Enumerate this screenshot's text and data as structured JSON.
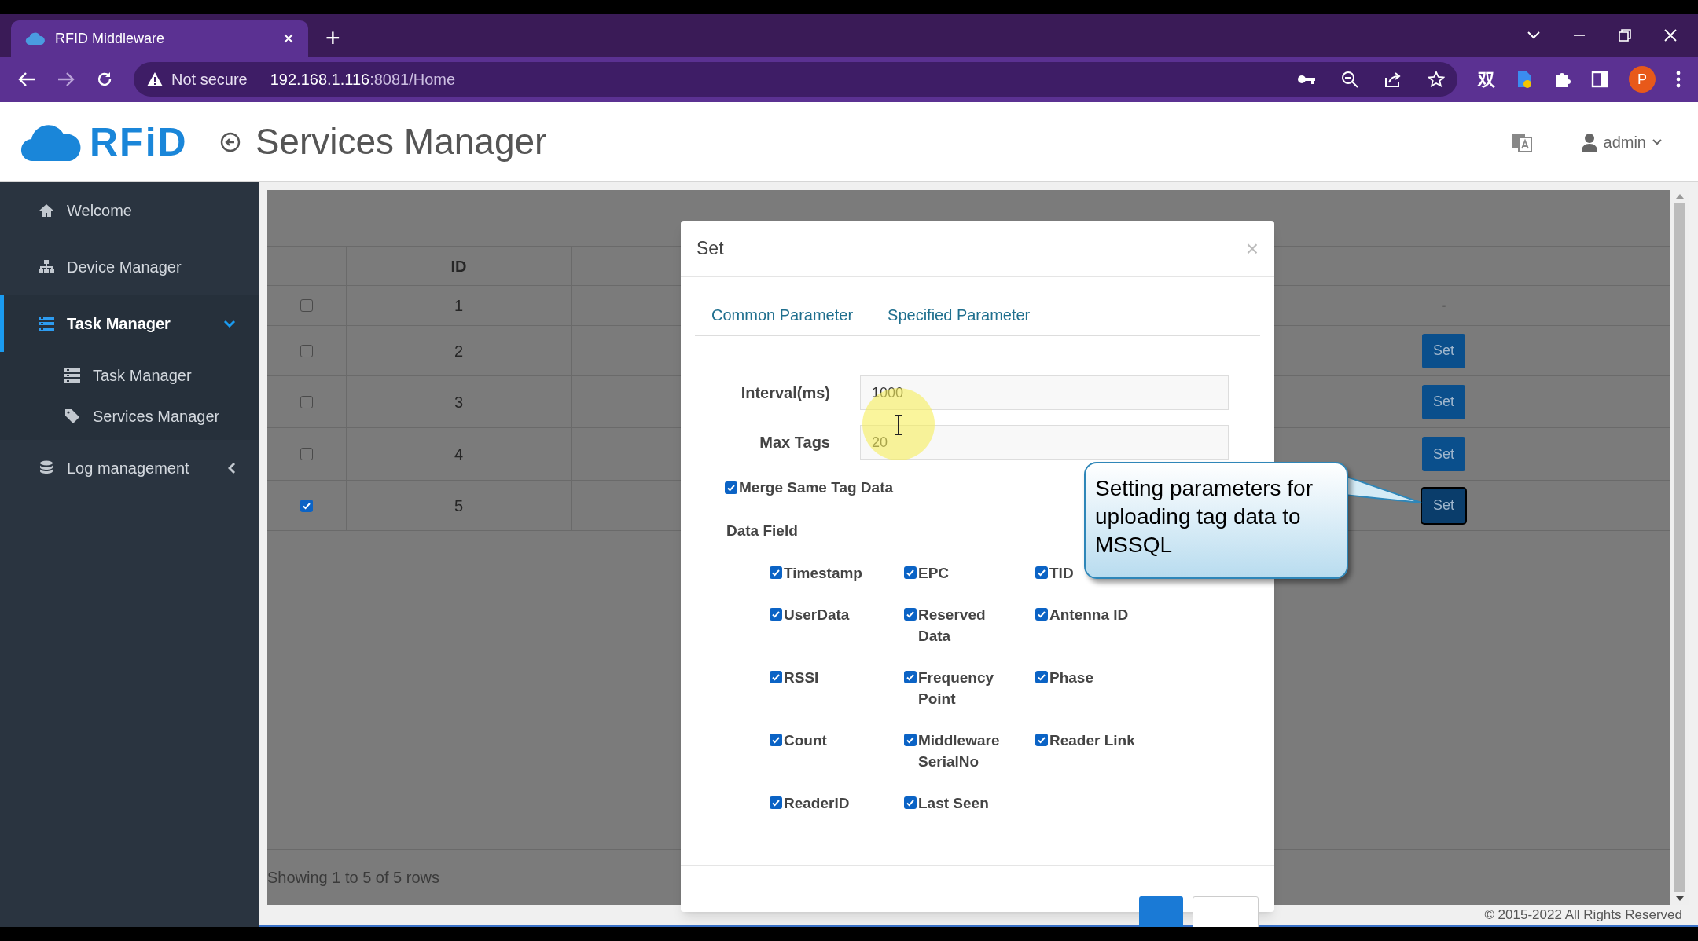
{
  "browser": {
    "tab_title": "RFID Middleware",
    "new_tab": "+",
    "security": "Not secure",
    "url_host": "192.168.1.116",
    "url_path": ":8081/Home",
    "extension_label": "双",
    "profile_initial": "P"
  },
  "header": {
    "logo_text": "RFiD",
    "title": "Services Manager",
    "user": "admin"
  },
  "sidebar": {
    "items": [
      {
        "label": "Welcome",
        "kind": "link",
        "selected": false
      },
      {
        "label": "Device Manager",
        "kind": "link",
        "selected": false
      },
      {
        "label": "Task Manager",
        "kind": "menu",
        "selected": true,
        "expanded": true,
        "children": [
          {
            "label": "Task Manager"
          },
          {
            "label": "Services Manager"
          }
        ]
      },
      {
        "label": "Log management",
        "kind": "menu",
        "selected": false,
        "expanded": false
      }
    ]
  },
  "table": {
    "columns": [
      "ID"
    ],
    "rows": [
      {
        "checked": false,
        "id": "1",
        "action": {
          "kind": "text",
          "text": "-"
        }
      },
      {
        "checked": false,
        "id": "2",
        "action": {
          "kind": "button",
          "label": "Set",
          "focused": false
        }
      },
      {
        "checked": false,
        "id": "3",
        "action": {
          "kind": "button",
          "label": "Set",
          "focused": false
        }
      },
      {
        "checked": false,
        "id": "4",
        "action": {
          "kind": "button",
          "label": "Set",
          "focused": false
        }
      },
      {
        "checked": true,
        "id": "5",
        "action": {
          "kind": "button",
          "label": "Set",
          "focused": true
        }
      }
    ],
    "footer": "Showing 1 to 5 of 5 rows"
  },
  "modal": {
    "title": "Set",
    "close": "×",
    "tabs": [
      "Common Parameter",
      "Specified Parameter"
    ],
    "fields": [
      {
        "label": "Interval(ms)",
        "value": "1000"
      },
      {
        "label": "Max Tags",
        "value": "20"
      }
    ],
    "merge": {
      "label": "Merge Same Tag Data",
      "checked": true
    },
    "section_label": "Data Field",
    "data_fields": [
      {
        "label": "Timestamp",
        "checked": true
      },
      {
        "label": "EPC",
        "checked": true
      },
      {
        "label": "TID",
        "checked": true
      },
      {
        "label": "UserData",
        "checked": true
      },
      {
        "label": "Reserved Data",
        "checked": true
      },
      {
        "label": "Antenna ID",
        "checked": true
      },
      {
        "label": "RSSI",
        "checked": true
      },
      {
        "label": "Frequency Point",
        "checked": true
      },
      {
        "label": "Phase",
        "checked": true
      },
      {
        "label": "Count",
        "checked": true
      },
      {
        "label": "Middleware SerialNo",
        "checked": true
      },
      {
        "label": "Reader Link",
        "checked": true
      },
      {
        "label": "ReaderID",
        "checked": true
      },
      {
        "label": "Last Seen",
        "checked": true
      }
    ]
  },
  "callout": {
    "text": "Setting parameters for uploading tag data to MSSQL"
  },
  "footer": {
    "copyright": "© 2015-2022 All Rights Reserved"
  }
}
